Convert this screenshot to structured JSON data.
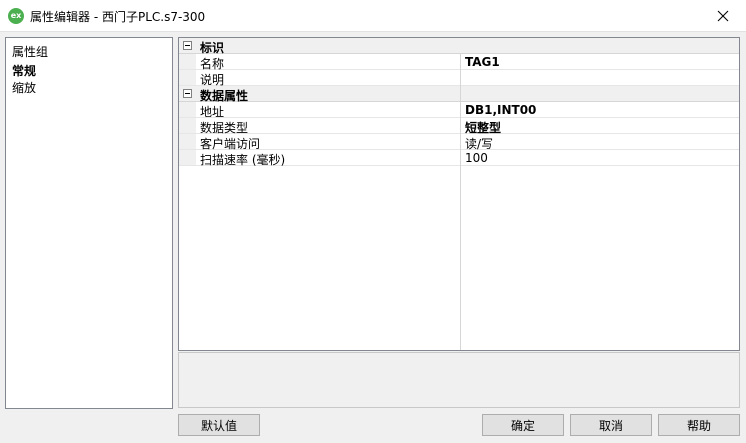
{
  "window": {
    "icon_text": "ex",
    "title": "属性编辑器 - 西门子PLC.s7-300"
  },
  "left_panel": {
    "header": "属性组",
    "items": [
      {
        "label": "常规",
        "selected": true
      },
      {
        "label": "缩放",
        "selected": false
      }
    ]
  },
  "property_grid": {
    "categories": [
      {
        "label": "标识",
        "expanded": true,
        "properties": [
          {
            "name": "名称",
            "value": "TAG1",
            "bold": true
          },
          {
            "name": "说明",
            "value": "",
            "bold": false
          }
        ]
      },
      {
        "label": "数据属性",
        "expanded": true,
        "properties": [
          {
            "name": "地址",
            "value": "DB1,INT00",
            "bold": true
          },
          {
            "name": "数据类型",
            "value": "短整型",
            "bold": true
          },
          {
            "name": "客户端访问",
            "value": "读/写",
            "bold": false
          },
          {
            "name": "扫描速率 (毫秒)",
            "value": "100",
            "bold": false
          }
        ]
      }
    ]
  },
  "buttons": {
    "default": "默认值",
    "ok": "确定",
    "cancel": "取消",
    "help": "帮助"
  }
}
